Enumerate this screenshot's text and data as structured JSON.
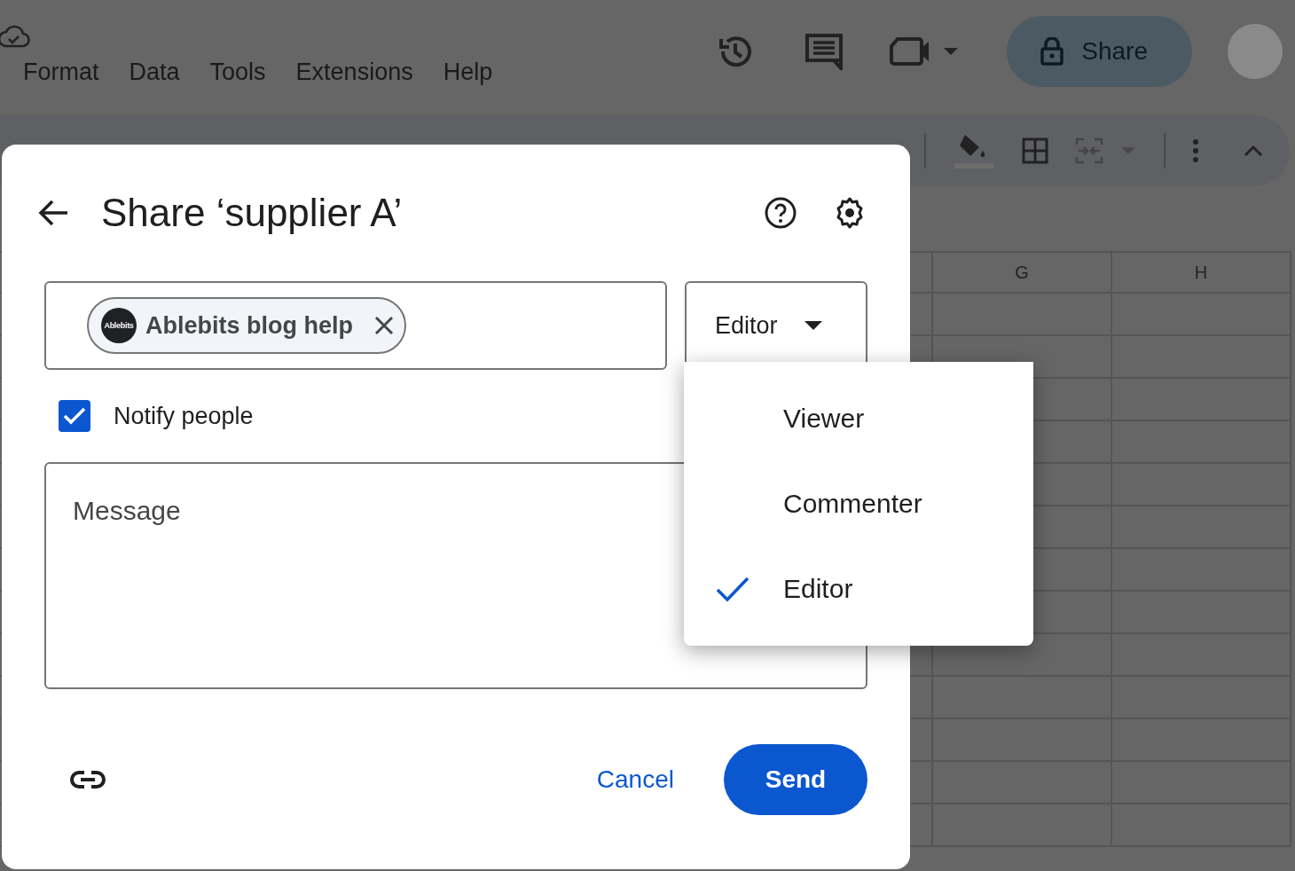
{
  "menu": [
    {
      "label": "Format"
    },
    {
      "label": "Data"
    },
    {
      "label": "Tools"
    },
    {
      "label": "Extensions"
    },
    {
      "label": "Help"
    }
  ],
  "header": {
    "share_button": "Share"
  },
  "grid": {
    "columns": [
      "G",
      "H"
    ]
  },
  "dialog": {
    "title": "Share ‘supplier A’",
    "recipient": {
      "name": "Ablebits blog help",
      "avatar_text": "Ablebits"
    },
    "role": "Editor",
    "notify": {
      "label": "Notify people",
      "checked": true
    },
    "message": {
      "placeholder": "Message"
    },
    "cancel": "Cancel",
    "send": "Send"
  },
  "role_menu": [
    {
      "label": "Viewer",
      "selected": false
    },
    {
      "label": "Commenter",
      "selected": false
    },
    {
      "label": "Editor",
      "selected": true
    }
  ]
}
